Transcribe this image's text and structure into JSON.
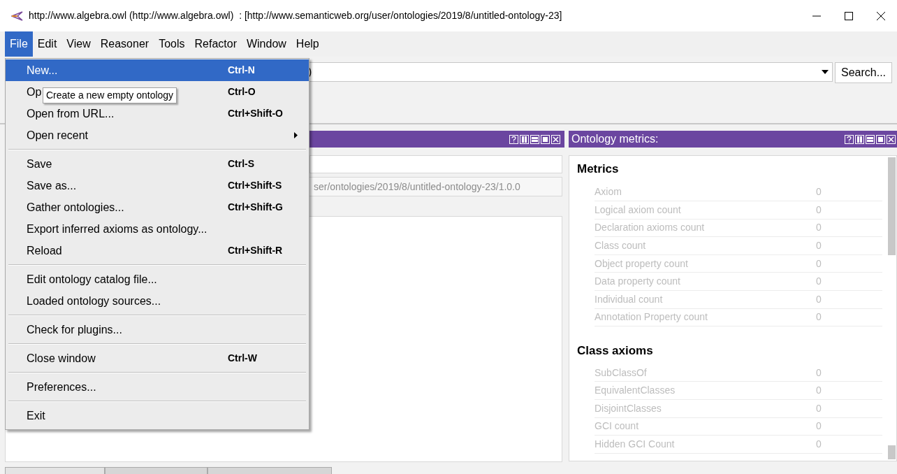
{
  "window": {
    "title": "http://www.algebra.owl (http://www.algebra.owl)  : [http://www.semanticweb.org/user/ontologies/2019/8/untitled-ontology-23]"
  },
  "menubar": [
    {
      "label": "File",
      "selected": true
    },
    {
      "label": "Edit",
      "selected": false
    },
    {
      "label": "View",
      "selected": false
    },
    {
      "label": "Reasoner",
      "selected": false
    },
    {
      "label": "Tools",
      "selected": false
    },
    {
      "label": "Refactor",
      "selected": false
    },
    {
      "label": "Window",
      "selected": false
    },
    {
      "label": "Help",
      "selected": false
    }
  ],
  "file_menu": {
    "groups": [
      [
        {
          "label": "New...",
          "shortcut": "Ctrl-N",
          "selected": true,
          "submenu": false
        },
        {
          "label": "Op",
          "shortcut": "Ctrl-O",
          "selected": false,
          "submenu": false
        },
        {
          "label": "Open from URL...",
          "shortcut": "Ctrl+Shift-O",
          "selected": false,
          "submenu": false
        },
        {
          "label": "Open recent",
          "selected": false,
          "submenu": true
        }
      ],
      [
        {
          "label": "Save",
          "shortcut": "Ctrl-S",
          "selected": false,
          "submenu": false
        },
        {
          "label": "Save as...",
          "shortcut": "Ctrl+Shift-S",
          "selected": false,
          "submenu": false
        },
        {
          "label": "Gather ontologies...",
          "shortcut": "Ctrl+Shift-G",
          "selected": false,
          "submenu": false
        },
        {
          "label": "Export inferred axioms as ontology...",
          "selected": false,
          "submenu": false
        },
        {
          "label": "Reload",
          "shortcut": "Ctrl+Shift-R",
          "selected": false,
          "submenu": false
        }
      ],
      [
        {
          "label": "Edit ontology catalog file...",
          "selected": false,
          "submenu": false
        },
        {
          "label": "Loaded ontology sources...",
          "selected": false,
          "submenu": false
        }
      ],
      [
        {
          "label": "Check for plugins...",
          "selected": false,
          "submenu": false
        }
      ],
      [
        {
          "label": "Close window",
          "shortcut": "Ctrl-W",
          "selected": false,
          "submenu": false
        }
      ],
      [
        {
          "label": "Preferences...",
          "selected": false,
          "submenu": false
        }
      ],
      [
        {
          "label": "Exit",
          "selected": false,
          "submenu": false
        }
      ]
    ]
  },
  "tooltip": "Create a new empty ontology",
  "toolbar": {
    "entity_field": {
      "value": ")"
    },
    "search_button": "Search..."
  },
  "bottom_tabs": [
    {
      "selected": true
    },
    {
      "selected": false
    },
    {
      "selected": false
    }
  ],
  "left_panel": {
    "version_iri": "ser/ontologies/2019/8/untitled-ontology-23/1.0.0"
  },
  "metrics_panel": {
    "title": "Ontology metrics:",
    "sections": [
      {
        "heading": "Metrics",
        "rows": [
          {
            "label": "Axiom",
            "value": "0"
          },
          {
            "label": "Logical axiom count",
            "value": "0"
          },
          {
            "label": "Declaration axioms count",
            "value": "0"
          },
          {
            "label": "Class count",
            "value": "0"
          },
          {
            "label": "Object property count",
            "value": "0"
          },
          {
            "label": "Data property count",
            "value": "0"
          },
          {
            "label": "Individual count",
            "value": "0"
          },
          {
            "label": "Annotation Property count",
            "value": "0"
          }
        ]
      },
      {
        "heading": "Class axioms",
        "rows": [
          {
            "label": "SubClassOf",
            "value": "0"
          },
          {
            "label": "EquivalentClasses",
            "value": "0"
          },
          {
            "label": "DisjointClasses",
            "value": "0"
          },
          {
            "label": "GCI count",
            "value": "0"
          },
          {
            "label": "Hidden GCI Count",
            "value": "0"
          }
        ]
      }
    ]
  }
}
